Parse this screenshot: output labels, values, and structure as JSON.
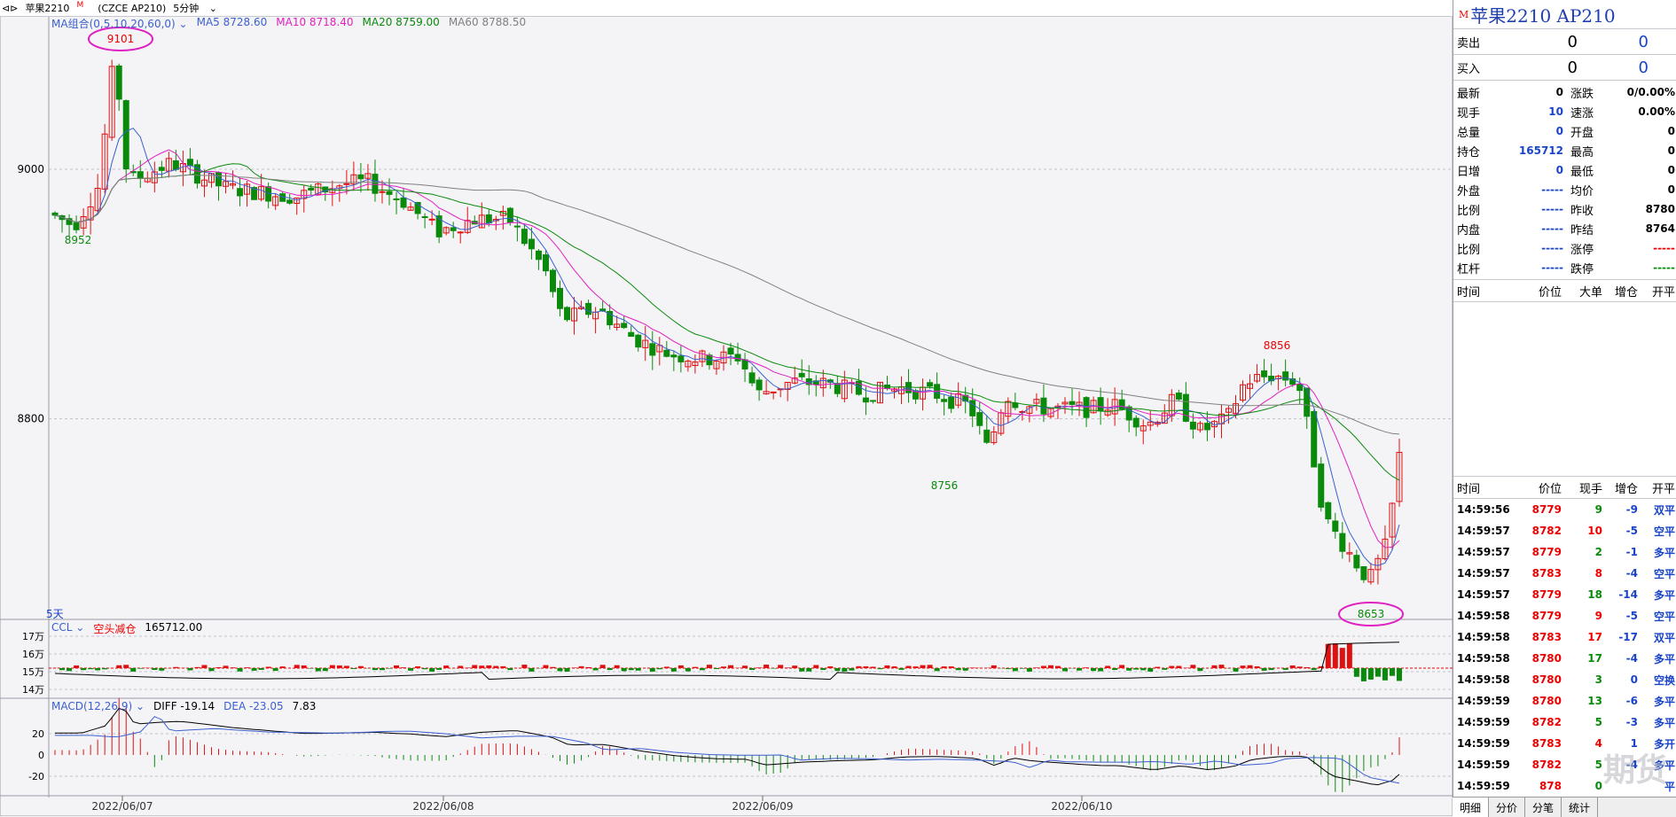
{
  "toolbar": {
    "symbol": "苹果2210",
    "flag": "M",
    "exchange": "(CZCE AP210)",
    "period": "5分钟"
  },
  "ma_legend": {
    "group": "MA组合(0,5,10,20,60,0)",
    "ma5": "MA5 8728.60",
    "ma10": "MA10 8718.40",
    "ma20": "MA20 8759.00",
    "ma60": "MA60 8788.50",
    "ma5_color": "#3a5fd0",
    "ma10_color": "#e020c0",
    "ma20_color": "#0a8a0a",
    "ma60_color": "#808080"
  },
  "price_axis": {
    "labels": [
      "9000",
      "8800"
    ]
  },
  "annotations": {
    "high": "9101",
    "low": "8653",
    "a": "8952",
    "b": "8856",
    "c": "8756"
  },
  "days_label": "5天",
  "ccl": {
    "name": "CCL",
    "label": "空头减仓",
    "value": "165712.00",
    "axis": [
      "17万",
      "16万",
      "15万",
      "14万"
    ]
  },
  "macd": {
    "name": "MACD(12,26,9)",
    "diff": "DIFF -19.14",
    "dea": "DEA -23.05",
    "macd": "7.83",
    "axis": [
      "20",
      "0",
      "-20"
    ]
  },
  "dates": [
    "2022/06/07",
    "2022/06/08",
    "2022/06/09",
    "2022/06/10"
  ],
  "panel": {
    "flag": "M",
    "title": "苹果2210 AP210",
    "sell_label": "卖出",
    "sell_price": "0",
    "sell_vol": "0",
    "buy_label": "买入",
    "buy_price": "0",
    "buy_vol": "0",
    "stats": [
      {
        "k": "最新",
        "v": "0",
        "vc": "",
        "k2": "涨跌",
        "v2": "0/0.00%",
        "v2c": ""
      },
      {
        "k": "现手",
        "v": "10",
        "vc": "blue",
        "k2": "速涨",
        "v2": "0.00%",
        "v2c": ""
      },
      {
        "k": "总量",
        "v": "0",
        "vc": "blue",
        "k2": "开盘",
        "v2": "0",
        "v2c": ""
      },
      {
        "k": "持仓",
        "v": "165712",
        "vc": "blue",
        "k2": "最高",
        "v2": "0",
        "v2c": ""
      },
      {
        "k": "日增",
        "v": "0",
        "vc": "blue",
        "k2": "最低",
        "v2": "0",
        "v2c": ""
      },
      {
        "k": "外盘",
        "v": "-----",
        "vc": "blue",
        "k2": "均价",
        "v2": "0",
        "v2c": ""
      },
      {
        "k": "比例",
        "v": "-----",
        "vc": "blue",
        "k2": "昨收",
        "v2": "8780",
        "v2c": ""
      },
      {
        "k": "内盘",
        "v": "-----",
        "vc": "blue",
        "k2": "昨结",
        "v2": "8764",
        "v2c": ""
      },
      {
        "k": "比例",
        "v": "-----",
        "vc": "blue",
        "k2": "涨停",
        "v2": "-----",
        "v2c": "red"
      },
      {
        "k": "杠杆",
        "v": "-----",
        "vc": "blue",
        "k2": "跌停",
        "v2": "-----",
        "v2c": "green"
      }
    ],
    "big_header": [
      "时间",
      "价位",
      "大单",
      "增仓",
      "开平"
    ],
    "tick_header": [
      "时间",
      "价位",
      "现手",
      "增仓",
      "开平"
    ],
    "ticks": [
      {
        "t": "14:59:56",
        "p": "8779",
        "q": "9",
        "d": "-9",
        "o": "双平",
        "pc": "red",
        "qc": "green"
      },
      {
        "t": "14:59:57",
        "p": "8782",
        "q": "10",
        "d": "-5",
        "o": "空平",
        "pc": "red",
        "qc": "red"
      },
      {
        "t": "14:59:57",
        "p": "8779",
        "q": "2",
        "d": "-1",
        "o": "多平",
        "pc": "red",
        "qc": "green"
      },
      {
        "t": "14:59:57",
        "p": "8783",
        "q": "8",
        "d": "-4",
        "o": "空平",
        "pc": "red",
        "qc": "red"
      },
      {
        "t": "14:59:57",
        "p": "8779",
        "q": "18",
        "d": "-14",
        "o": "多平",
        "pc": "red",
        "qc": "green"
      },
      {
        "t": "14:59:58",
        "p": "8779",
        "q": "9",
        "d": "-5",
        "o": "空平",
        "pc": "red",
        "qc": "red"
      },
      {
        "t": "14:59:58",
        "p": "8783",
        "q": "17",
        "d": "-17",
        "o": "双平",
        "pc": "red",
        "qc": "red"
      },
      {
        "t": "14:59:58",
        "p": "8780",
        "q": "17",
        "d": "-4",
        "o": "多平",
        "pc": "red",
        "qc": "green"
      },
      {
        "t": "14:59:58",
        "p": "8780",
        "q": "3",
        "d": "0",
        "o": "空换",
        "pc": "red",
        "qc": "green"
      },
      {
        "t": "14:59:59",
        "p": "8780",
        "q": "13",
        "d": "-6",
        "o": "多平",
        "pc": "red",
        "qc": "green"
      },
      {
        "t": "14:59:59",
        "p": "8782",
        "q": "5",
        "d": "-3",
        "o": "多平",
        "pc": "red",
        "qc": "green"
      },
      {
        "t": "14:59:59",
        "p": "8783",
        "q": "4",
        "d": "1",
        "o": "多开",
        "pc": "red",
        "qc": "red"
      },
      {
        "t": "14:59:59",
        "p": "8782",
        "q": "5",
        "d": "-4",
        "o": "多平",
        "pc": "red",
        "qc": "green"
      },
      {
        "t": "14:59:59",
        "p": "878",
        "q": "0",
        "d": "",
        "o": "平",
        "pc": "red",
        "qc": "green"
      }
    ],
    "tabs": [
      "明细",
      "分价",
      "分笔",
      "统计"
    ]
  },
  "watermark": "期货",
  "colors": {
    "up": "#e01010",
    "down": "#0a8a0a",
    "bg": "#f4f4f7"
  }
}
